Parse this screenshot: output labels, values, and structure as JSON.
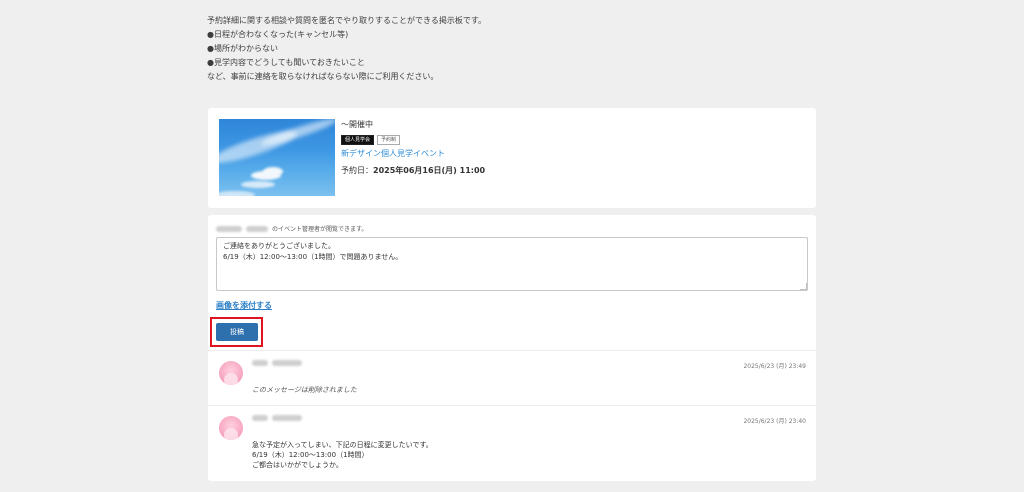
{
  "intro": {
    "lines": [
      "予約詳細に関する相談や質問を匿名でやり取りすることができる掲示板です。",
      "●日程が合わなくなった(キャンセル等)",
      "●場所がわからない",
      "●見学内容でどうしても聞いておきたいこと",
      "など、事前に連絡を取らなければならない際にご利用ください。"
    ]
  },
  "event": {
    "status": "～開催中",
    "tags": [
      "個人見学会",
      "予約制"
    ],
    "title": "新デザイン個人見学イベント",
    "date_label": "予約日：",
    "date_value": "2025年06月16日(月) 11:00"
  },
  "post_form": {
    "notice": "のイベント管理者が閲覧できます。",
    "message": "ご連絡をありがとうございました。\n6/19（木）12:00〜13:00（1時間）で問題ありません。",
    "attach_link": "画像を添付する",
    "submit_label": "投稿"
  },
  "comments": [
    {
      "date": "2025/6/23 (月) 23:49",
      "body": [
        "このメッセージは削除されました"
      ],
      "deleted": true
    },
    {
      "date": "2025/6/23 (月) 23:40",
      "body": [
        "急な予定が入ってしまい、下記の日程に変更したいです。",
        "6/19（木）12:00〜13:00（1時間）",
        "ご都合はいかがでしょうか。"
      ],
      "deleted": false
    }
  ],
  "colors": {
    "link": "#2d8bd6",
    "button": "#2e6fad",
    "highlight": "#e0141e",
    "background": "#efefef"
  }
}
